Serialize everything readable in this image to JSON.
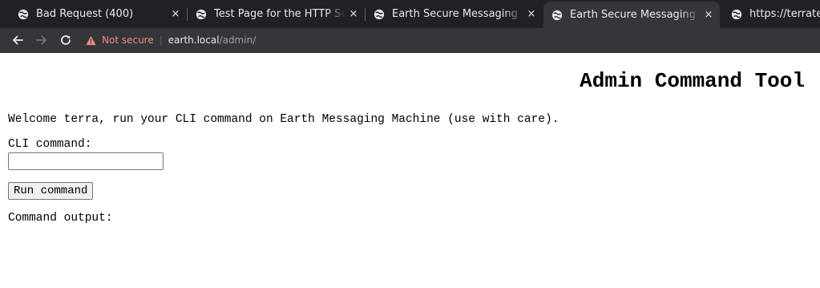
{
  "browser": {
    "tabs": [
      {
        "title": "Bad Request (400)",
        "icon": "globe-icon",
        "active": false
      },
      {
        "title": "Test Page for the HTTP Se",
        "icon": "globe-icon",
        "active": false
      },
      {
        "title": "Earth Secure Messaging",
        "icon": "globe-icon",
        "active": false
      },
      {
        "title": "Earth Secure Messaging A",
        "icon": "globe-icon",
        "active": true
      },
      {
        "title": "https://terrates",
        "icon": "globe-icon",
        "active": false
      }
    ],
    "close_glyph": "×",
    "toolbar": {
      "back_icon": "arrow-left-icon",
      "forward_icon": "arrow-right-icon",
      "reload_icon": "reload-icon",
      "security_text": "Not secure",
      "url_host": "earth.local",
      "url_path": "/admin/"
    },
    "colors": {
      "tabstrip_bg": "#202124",
      "toolbar_bg": "#35363a",
      "warning": "#f28b82"
    }
  },
  "page": {
    "heading": "Admin Command Tool",
    "welcome": "Welcome terra, run your CLI command on Earth Messaging Machine (use with care).",
    "cli_label": "CLI command:",
    "cli_value": "",
    "run_button": "Run command",
    "output_label": "Command output:"
  }
}
